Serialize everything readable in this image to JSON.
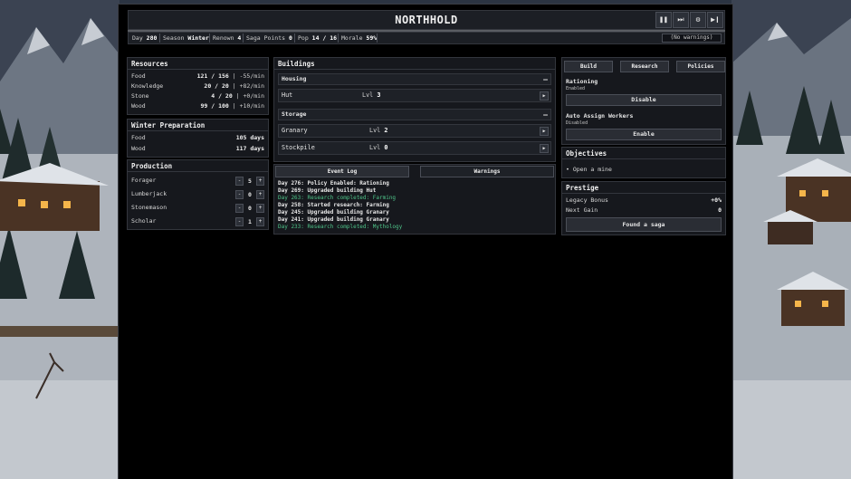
{
  "game": {
    "title": "NORTHHOLD",
    "controls": [
      {
        "icon": "pause-icon",
        "glyph": "❚❚"
      },
      {
        "icon": "fast-forward-icon",
        "glyph": "⏭"
      },
      {
        "icon": "gear-icon",
        "glyph": "⚙"
      },
      {
        "icon": "step-forward-icon",
        "glyph": "▶❙"
      }
    ]
  },
  "status": {
    "day_label": "Day",
    "day": "280",
    "season_label": "Season",
    "season": "Winter",
    "renown_label": "Renown",
    "renown": "4",
    "saga_label": "Saga Points",
    "saga": "0",
    "pop_label": "Pop",
    "pop": "14 / 16",
    "morale_label": "Morale",
    "morale": "59%",
    "warnings": "(No warnings)"
  },
  "resources": {
    "title": "Resources",
    "items": [
      {
        "label": "Food",
        "amount": "121 / 156",
        "rate": "-55/min"
      },
      {
        "label": "Knowledge",
        "amount": "20 / 20",
        "rate": "+82/min"
      },
      {
        "label": "Stone",
        "amount": "4 / 20",
        "rate": "+0/min"
      },
      {
        "label": "Wood",
        "amount": "99 / 100",
        "rate": "+10/min"
      }
    ]
  },
  "winter_prep": {
    "title": "Winter Preparation",
    "items": [
      {
        "label": "Food",
        "value": "105 days"
      },
      {
        "label": "Wood",
        "value": "117 days"
      }
    ]
  },
  "production": {
    "title": "Production",
    "items": [
      {
        "label": "Forager",
        "count": "5"
      },
      {
        "label": "Lumberjack",
        "count": "0"
      },
      {
        "label": "Stonemason",
        "count": "0"
      },
      {
        "label": "Scholar",
        "count": "1"
      }
    ],
    "minus": "-",
    "plus": "+"
  },
  "buildings": {
    "title": "Buildings",
    "housing": {
      "label": "Housing",
      "items": [
        {
          "name": "Hut",
          "lvl_label": "Lvl",
          "lvl": "3"
        }
      ]
    },
    "storage": {
      "label": "Storage",
      "items": [
        {
          "name": "Granary",
          "lvl_label": "Lvl",
          "lvl": "2"
        },
        {
          "name": "Stockpile",
          "lvl_label": "Lvl",
          "lvl": "0"
        }
      ]
    },
    "collapse": "—",
    "arrow": "▶"
  },
  "log": {
    "tabs": [
      "Event Log",
      "Warnings"
    ],
    "entries": [
      {
        "text": "Day 276: Policy Enabled: Rationing",
        "kind": "normal"
      },
      {
        "text": "Day 269: Upgraded building Hut",
        "kind": "normal"
      },
      {
        "text": "Day 263: Research completed: Farming",
        "kind": "green"
      },
      {
        "text": "Day 258: Started research: Farming",
        "kind": "normal"
      },
      {
        "text": "Day 245: Upgraded building Granary",
        "kind": "normal"
      },
      {
        "text": "Day 241: Upgraded building Granary",
        "kind": "normal"
      },
      {
        "text": "Day 233: Research completed: Mythology",
        "kind": "green"
      }
    ]
  },
  "right_tabs": [
    "Build",
    "Research",
    "Policies"
  ],
  "policies": [
    {
      "name": "Rationing",
      "state": "Enabled",
      "button": "Disable"
    },
    {
      "name": "Auto Assign Workers",
      "state": "Disabled",
      "button": "Enable"
    }
  ],
  "objectives": {
    "title": "Objectives",
    "items": [
      "Open a mine"
    ]
  },
  "prestige": {
    "title": "Prestige",
    "legacy_label": "Legacy Bonus",
    "legacy": "+0%",
    "next_label": "Next Gain",
    "next": "0",
    "button": "Found a saga"
  },
  "colors": {
    "panel": "#16181d",
    "border": "#33363d",
    "accent_green": "#4fc58a",
    "background": "#000000"
  }
}
